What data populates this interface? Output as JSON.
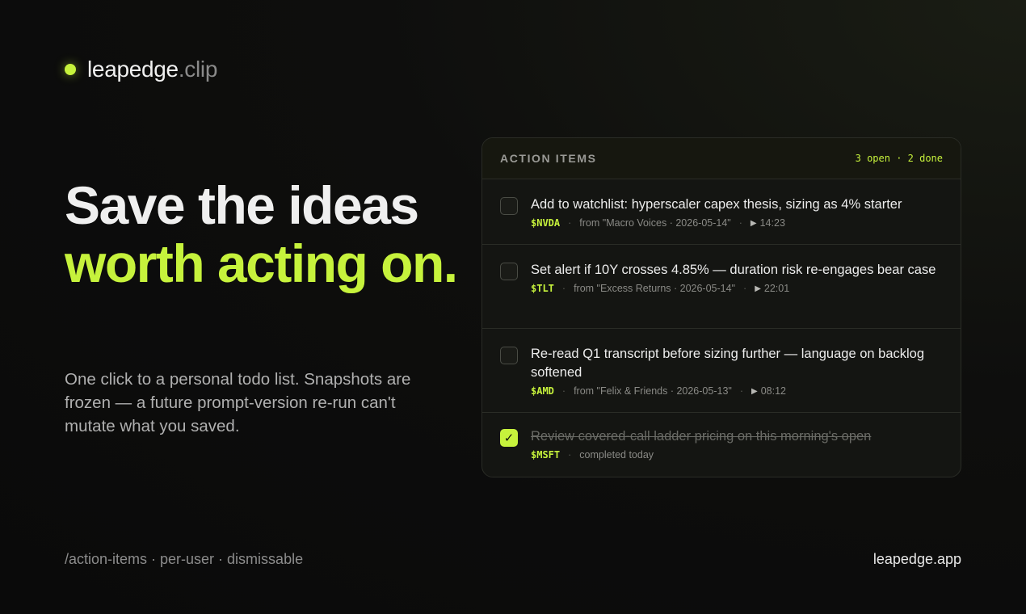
{
  "brand": {
    "name": "leapedge",
    "suffix": ".clip",
    "accent": "#c6f23c"
  },
  "hero": {
    "line1": "Save the ideas",
    "line2": "worth acting on."
  },
  "subtitle": "One click to a personal todo list. Snapshots are frozen — a future prompt-version re-run can't mutate what you saved.",
  "panel": {
    "title": "ACTION ITEMS",
    "counts": "3 open · 2 done",
    "items": [
      {
        "text": "Add to watchlist: hyperscaler capex thesis, sizing as 4% starter",
        "ticker": "$NVDA",
        "source": "from \"Macro Voices · 2026-05-14\"",
        "time": "14:23",
        "done": false
      },
      {
        "text": "Set alert if 10Y crosses 4.85% — duration risk re-engages bear case",
        "ticker": "$TLT",
        "source": "from \"Excess Returns · 2026-05-14\"",
        "time": "22:01",
        "done": false
      },
      {
        "text": "Re-read Q1 transcript before sizing further — language on backlog softened",
        "ticker": "$AMD",
        "source": "from \"Felix & Friends · 2026-05-13\"",
        "time": "08:12",
        "done": false
      },
      {
        "text": "Review covered-call ladder pricing on this morning's open",
        "ticker": "$MSFT",
        "status": "completed today",
        "done": true
      }
    ]
  },
  "footer": {
    "left": "/action-items · per-user · dismissable",
    "right": "leapedge.app"
  },
  "icons": {
    "play": "play-icon",
    "check": "check-icon",
    "dot": "status-dot-icon"
  }
}
